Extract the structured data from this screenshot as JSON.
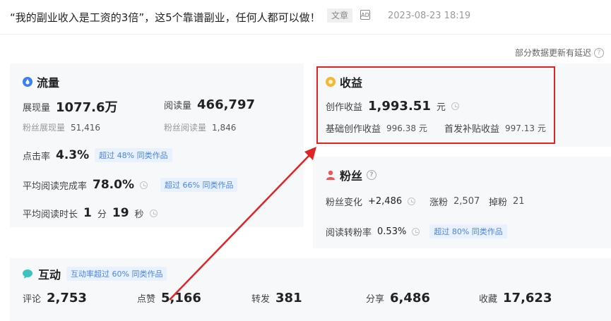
{
  "header": {
    "title": "“我的副业收入是工资的3倍”，这5个靠谱副业，任何人都可以做！",
    "type_tag": "文章",
    "ad_label": "AD",
    "timestamp": "2023-08-23 18:19"
  },
  "notice": "部分数据更新有延迟",
  "traffic": {
    "title": "流量",
    "impressions_label": "展现量",
    "impressions_value": "1077.6万",
    "reads_label": "阅读量",
    "reads_value": "466,797",
    "fan_impressions_label": "粉丝展现量",
    "fan_impressions_value": "51,416",
    "fan_reads_label": "粉丝阅读量",
    "fan_reads_value": "1,846",
    "ctr_label": "点击率",
    "ctr_value": "4.3%",
    "ctr_badge": "超过 48% 同类作品",
    "completion_label": "平均阅读完成率",
    "completion_value": "78.0%",
    "completion_badge": "超过 66% 同类作品",
    "duration_label": "平均阅读时长",
    "duration_min": "1",
    "duration_min_unit": "分",
    "duration_sec": "19",
    "duration_sec_unit": "秒"
  },
  "income": {
    "title": "收益",
    "creation_label": "创作收益",
    "creation_value": "1,993.51",
    "creation_unit": "元",
    "basic_label": "基础创作收益",
    "basic_value": "996.38 元",
    "premiere_label": "首发补贴收益",
    "premiere_value": "997.13 元"
  },
  "fans": {
    "title": "粉丝",
    "change_label": "粉丝变化",
    "change_value": "+2,486",
    "gain_label": "涨粉",
    "gain_value": "2,507",
    "loss_label": "掉粉",
    "loss_value": "21",
    "conversion_label": "阅读转粉率",
    "conversion_value": "0.53%",
    "conversion_badge": "超过 80% 同类作品"
  },
  "interaction": {
    "title": "互动",
    "badge": "互动率超过 60% 同类作品",
    "comments_label": "评论",
    "comments_value": "2,753",
    "likes_label": "点赞",
    "likes_value": "5,166",
    "shares_label": "转发",
    "shares_value": "381",
    "share_label": "分享",
    "share_value": "6,486",
    "favorites_label": "收藏",
    "favorites_value": "17,623"
  },
  "colors": {
    "accent_blue": "#4a86e8",
    "annotation_red": "#e02424",
    "income_icon": "#f5b82e",
    "fans_icon": "#e8585a",
    "interaction_icon": "#3cc3c0"
  }
}
